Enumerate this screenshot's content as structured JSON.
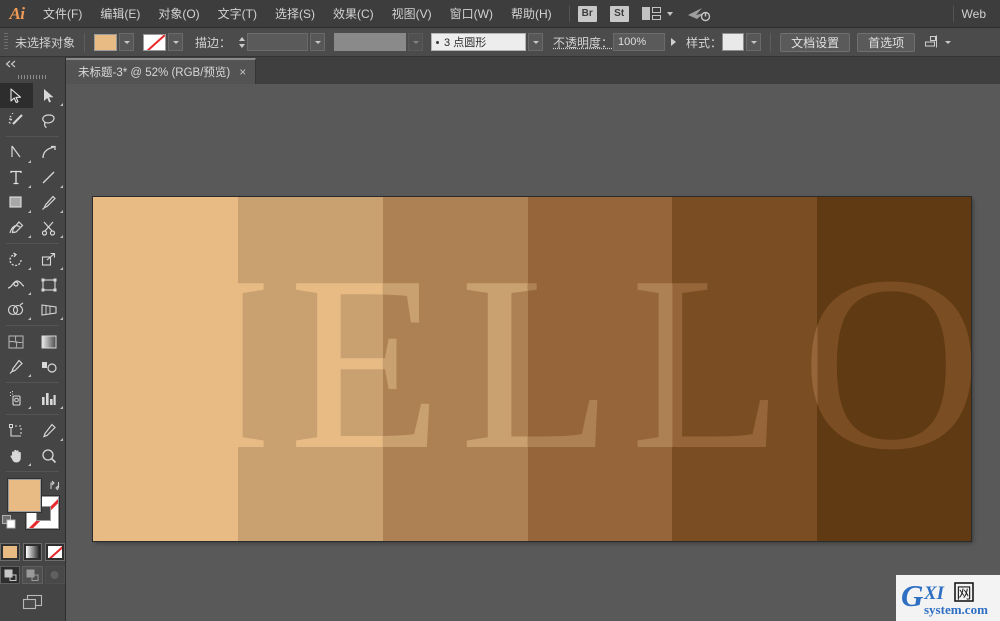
{
  "app": {
    "name": "Ai",
    "logo_color": "#ef9a56"
  },
  "menubar": {
    "items": [
      {
        "label": "文件(F)",
        "name": "menu-file"
      },
      {
        "label": "编辑(E)",
        "name": "menu-edit"
      },
      {
        "label": "对象(O)",
        "name": "menu-object"
      },
      {
        "label": "文字(T)",
        "name": "menu-type"
      },
      {
        "label": "选择(S)",
        "name": "menu-select"
      },
      {
        "label": "效果(C)",
        "name": "menu-effect"
      },
      {
        "label": "视图(V)",
        "name": "menu-view"
      },
      {
        "label": "窗口(W)",
        "name": "menu-window"
      },
      {
        "label": "帮助(H)",
        "name": "menu-help"
      }
    ],
    "bridge_badge": "Br",
    "stock_badge": "St",
    "workspace_label": "Web",
    "layout_icon": "arrange-documents-icon",
    "stock_icon": "adobe-stock-icon"
  },
  "controlbar": {
    "selection_status": "未选择对象",
    "fill_label": "填色",
    "fill_color": "#e8bb84",
    "stroke_swatch_label": "描边颜色",
    "stroke_label": "描边：",
    "stroke_weight": "",
    "stroke_profile": "",
    "brush_definition": "3 点圆形",
    "opacity_label": "不透明度：",
    "opacity_value": "100%",
    "style_label": "样式：",
    "document_setup_button": "文档设置",
    "preferences_button": "首选项",
    "align_icon": "align-objects-icon"
  },
  "document_tab": {
    "title": "未标题-3* @ 52% (RGB/预览)",
    "close_label": "×",
    "zoom": "52%",
    "color_mode": "RGB",
    "view_mode": "预览"
  },
  "toolpanel": {
    "collapse_icon": "double-chevron-left-icon",
    "tools": [
      {
        "name": "selection-tool",
        "active": true,
        "flyout": false
      },
      {
        "name": "direct-selection-tool",
        "active": false,
        "flyout": true
      },
      {
        "name": "magic-wand-tool",
        "active": false,
        "flyout": false
      },
      {
        "name": "lasso-tool",
        "active": false,
        "flyout": false
      },
      {
        "name": "pen-tool",
        "active": false,
        "flyout": true
      },
      {
        "name": "curvature-tool",
        "active": false,
        "flyout": false
      },
      {
        "name": "type-tool",
        "active": false,
        "flyout": true
      },
      {
        "name": "line-segment-tool",
        "active": false,
        "flyout": true
      },
      {
        "name": "rectangle-tool",
        "active": false,
        "flyout": true
      },
      {
        "name": "paintbrush-tool",
        "active": false,
        "flyout": true
      },
      {
        "name": "shaper-tool",
        "active": false,
        "flyout": true
      },
      {
        "name": "scissors-tool",
        "active": false,
        "flyout": true
      },
      {
        "name": "rotate-tool",
        "active": false,
        "flyout": true
      },
      {
        "name": "scale-tool",
        "active": false,
        "flyout": true
      },
      {
        "name": "width-tool",
        "active": false,
        "flyout": true
      },
      {
        "name": "free-transform-tool",
        "active": false,
        "flyout": false
      },
      {
        "name": "shape-builder-tool",
        "active": false,
        "flyout": true
      },
      {
        "name": "perspective-grid-tool",
        "active": false,
        "flyout": true
      },
      {
        "name": "mesh-tool",
        "active": false,
        "flyout": false
      },
      {
        "name": "gradient-tool",
        "active": false,
        "flyout": false
      },
      {
        "name": "eyedropper-tool",
        "active": false,
        "flyout": true
      },
      {
        "name": "blend-tool",
        "active": false,
        "flyout": false
      },
      {
        "name": "symbol-sprayer-tool",
        "active": false,
        "flyout": true
      },
      {
        "name": "column-graph-tool",
        "active": false,
        "flyout": true
      },
      {
        "name": "artboard-tool",
        "active": false,
        "flyout": false
      },
      {
        "name": "slice-tool",
        "active": false,
        "flyout": true
      },
      {
        "name": "hand-tool",
        "active": false,
        "flyout": true
      },
      {
        "name": "zoom-tool",
        "active": false,
        "flyout": false
      }
    ],
    "fill_color": "#e8bb84",
    "stroke_color": "none",
    "swap_icon": "swap-fill-stroke-icon",
    "default_icon": "default-fill-stroke-icon",
    "color_mode_buttons": [
      "color-fill-icon",
      "gradient-fill-icon",
      "none-fill-icon"
    ],
    "color_mode_selected": 0,
    "draw_modes": [
      "draw-normal-icon",
      "draw-behind-icon",
      "draw-inside-icon"
    ],
    "draw_mode_selected": 0,
    "screen_mode_icon": "change-screen-mode-icon"
  },
  "artwork": {
    "description": "HELLO 文字与渐变色块",
    "text": "HELLO",
    "letters": [
      "H",
      "E",
      "L",
      "L",
      "O"
    ],
    "band_colors": [
      "#e8bb84",
      "#c9a070",
      "#ae8154",
      "#97653a",
      "#7b4d23",
      "#603a12"
    ],
    "text_color_shift": "每个字母显示为比所在色块浅一级的颜色",
    "background_color": "#595959",
    "artboard_border": "#2b2b2b"
  },
  "watermark": {
    "brand": "GXI",
    "cjk": "网",
    "domain": "system.com",
    "brand_color": "#2e6fc4",
    "g_color": "#2e6fc4"
  }
}
